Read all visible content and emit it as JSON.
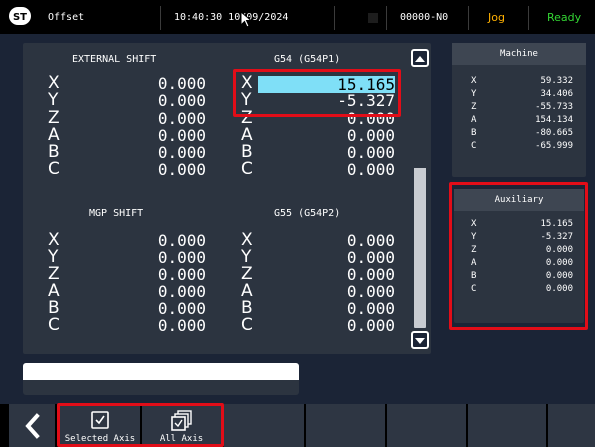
{
  "topbar": {
    "screen_name": "Offset",
    "datetime": "10:40:30 10/09/2024",
    "program": "00000-N0",
    "mode": "Jog",
    "status": "Ready"
  },
  "offsets": {
    "external_shift": {
      "title": "EXTERNAL SHIFT",
      "axes": [
        "X",
        "Y",
        "Z",
        "A",
        "B",
        "C"
      ],
      "values": [
        "0.000",
        "0.000",
        "0.000",
        "0.000",
        "0.000",
        "0.000"
      ]
    },
    "g54": {
      "title": "G54 (G54P1)",
      "axes": [
        "X",
        "Y",
        "Z",
        "A",
        "B",
        "C"
      ],
      "values": [
        "15.165",
        "-5.327",
        "0.000",
        "0.000",
        "0.000",
        "0.000"
      ],
      "selected_axis": "X"
    },
    "mgp_shift": {
      "title": "MGP SHIFT",
      "axes": [
        "X",
        "Y",
        "Z",
        "A",
        "B",
        "C"
      ],
      "values": [
        "0.000",
        "0.000",
        "0.000",
        "0.000",
        "0.000",
        "0.000"
      ]
    },
    "g55": {
      "title": "G55 (G54P2)",
      "axes": [
        "X",
        "Y",
        "Z",
        "A",
        "B",
        "C"
      ],
      "values": [
        "0.000",
        "0.000",
        "0.000",
        "0.000",
        "0.000",
        "0.000"
      ]
    }
  },
  "machine": {
    "title": "Machine",
    "axes": [
      "X",
      "Y",
      "Z",
      "A",
      "B",
      "C"
    ],
    "values": [
      "59.332",
      "34.406",
      "-55.733",
      "154.134",
      "-80.665",
      "-65.999"
    ]
  },
  "auxiliary": {
    "title": "Auxiliary",
    "axes": [
      "X",
      "Y",
      "Z",
      "A",
      "B",
      "C"
    ],
    "values": [
      "15.165",
      "-5.327",
      "0.000",
      "0.000",
      "0.000",
      "0.000"
    ]
  },
  "input": {
    "value": ""
  },
  "softkeys": {
    "selected_axis": "Selected Axis",
    "all_axis": "All Axis"
  },
  "colors": {
    "background": "#1b2436",
    "panel": "#2c3440",
    "highlight": "#7fdff7",
    "mode_jog": "#ffb000",
    "status_ready": "#33d633",
    "annotation_red": "#e20d18"
  },
  "icons": {
    "back": "chevron-left-icon",
    "selected_axis": "checkbox-checked-icon",
    "all_axis": "stacked-checkbox-icon",
    "scroll_up": "triangle-up-icon",
    "scroll_down": "triangle-down-icon"
  }
}
